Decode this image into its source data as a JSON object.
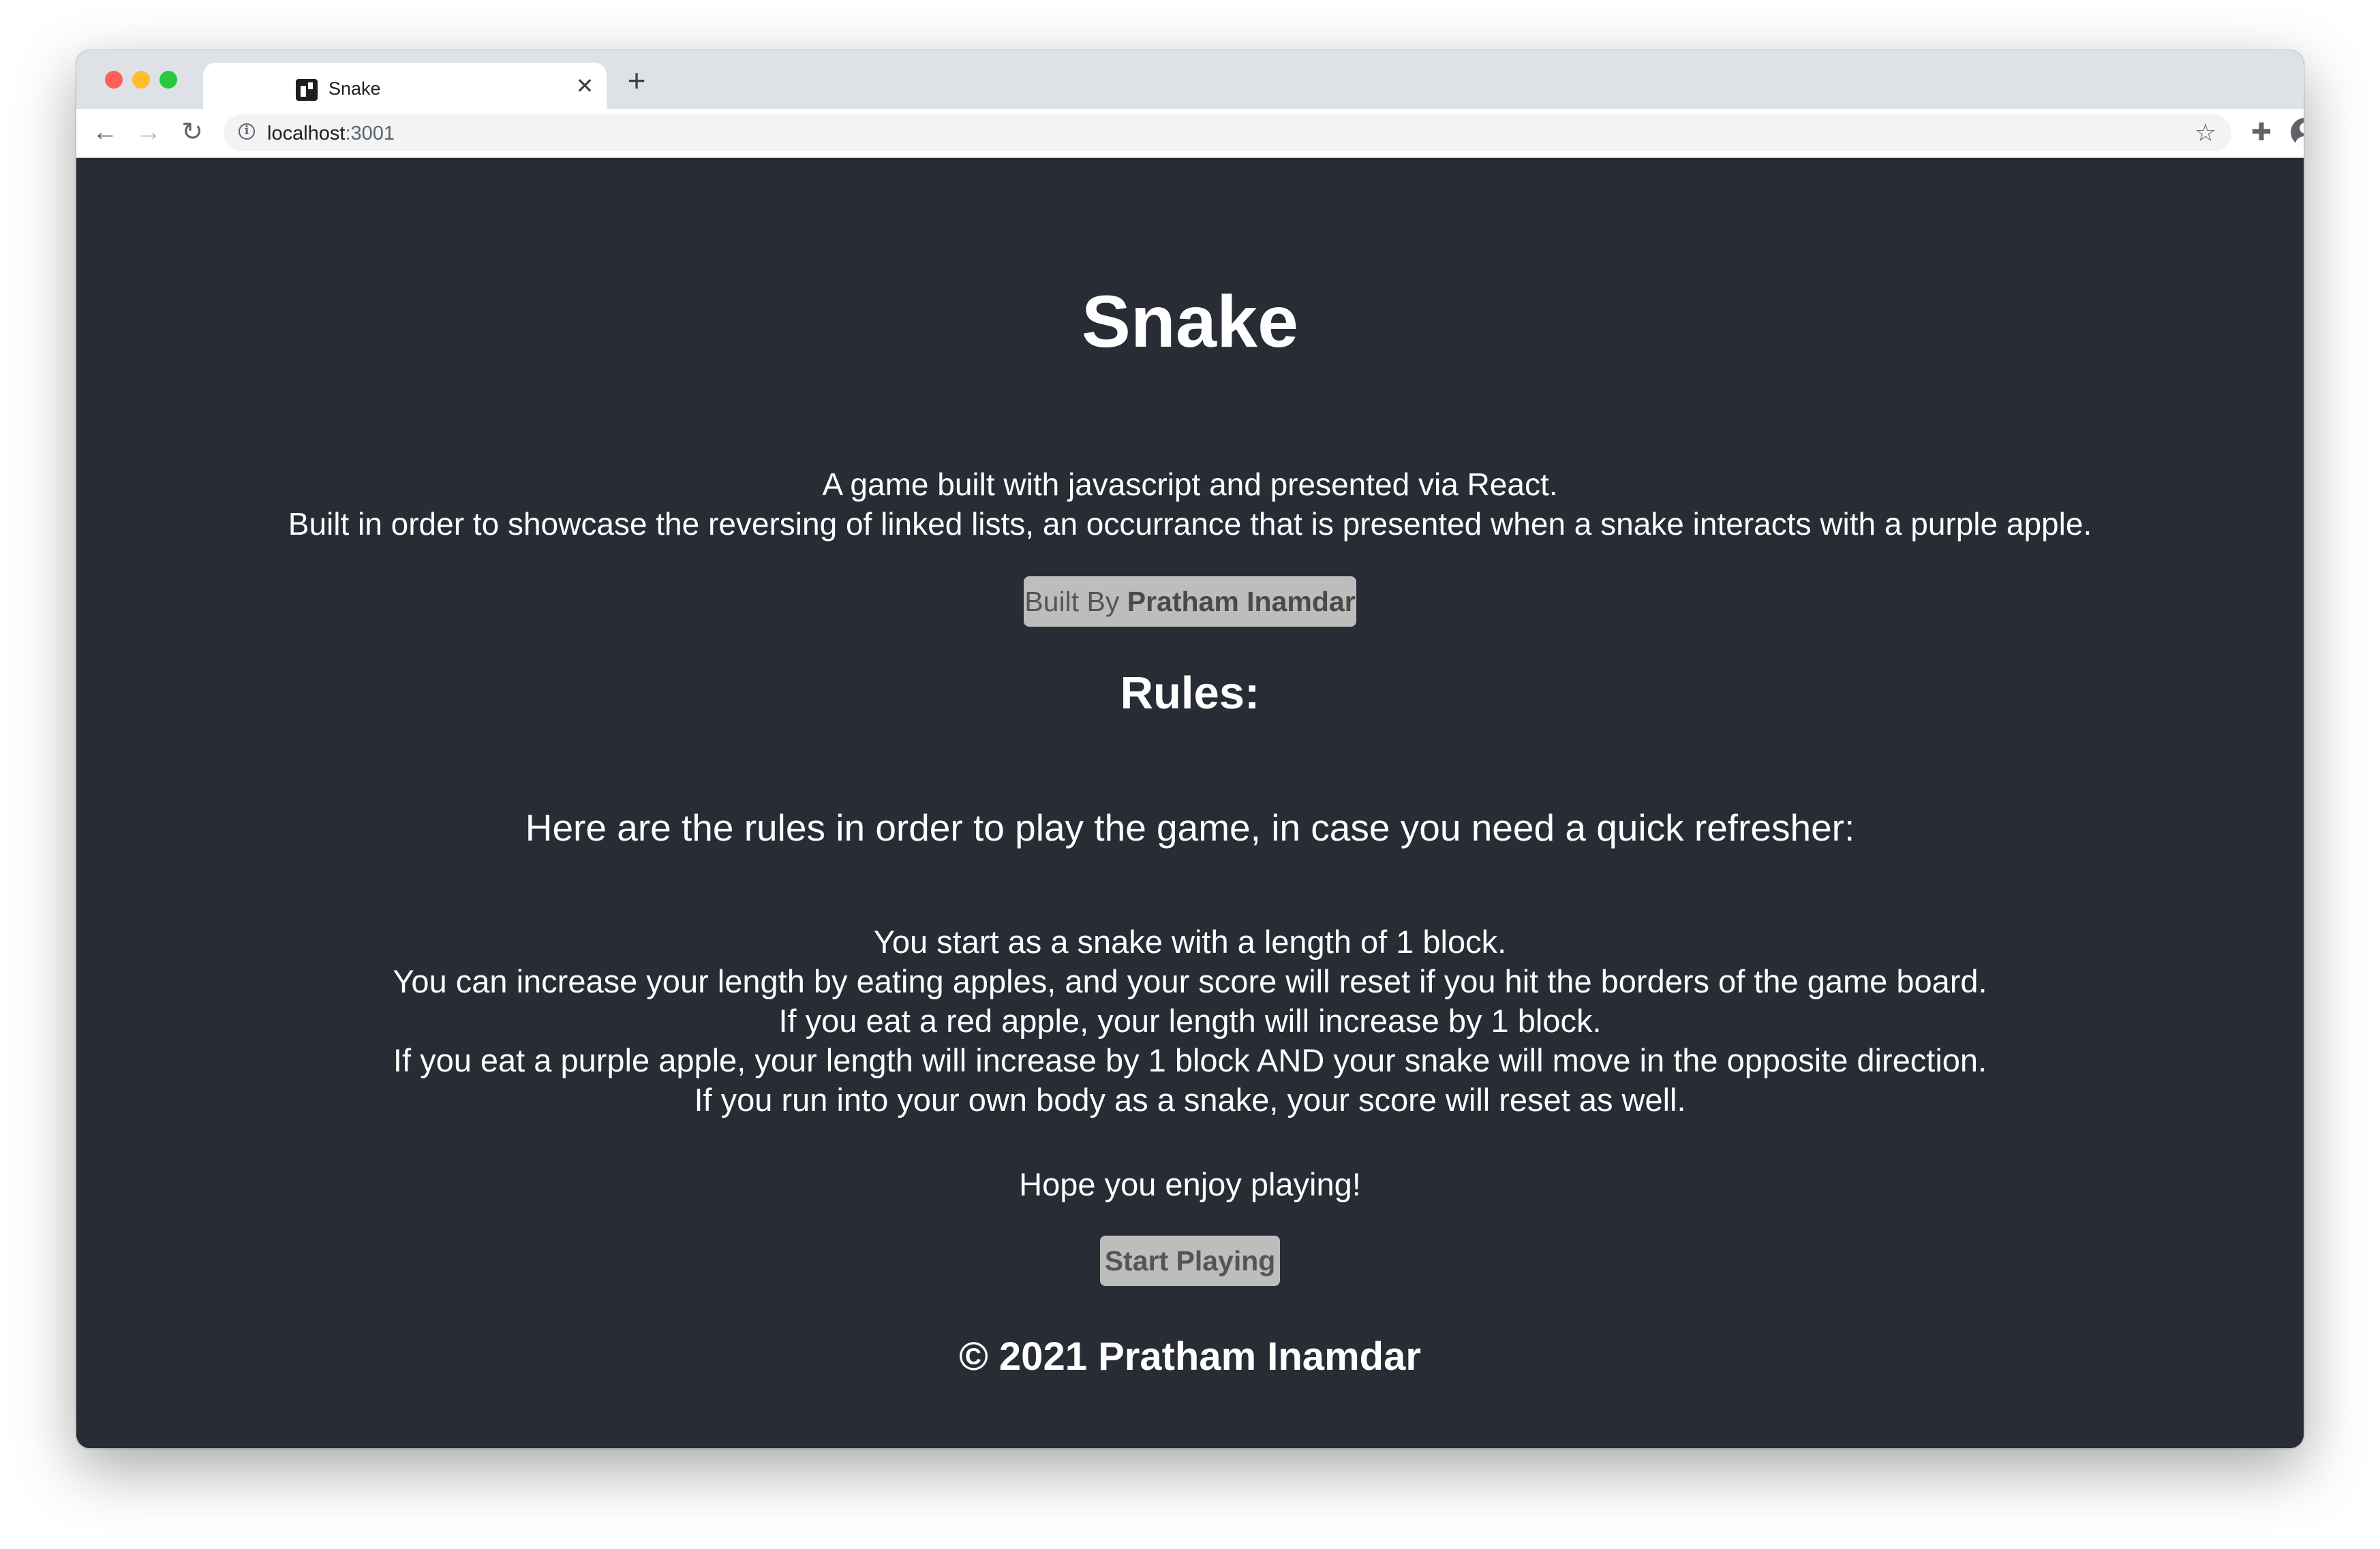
{
  "browser": {
    "tab": {
      "title": "Snake",
      "favicon": "react-app-icon",
      "close_glyph": "✕"
    },
    "new_tab_glyph": "+",
    "toolbar": {
      "back_glyph": "←",
      "forward_glyph": "→",
      "reload_glyph": "↻",
      "url_host": "localhost",
      "url_port": ":3001",
      "bookmark_glyph": "☆",
      "extensions_glyph": "✚",
      "menu_glyph": "⋮"
    },
    "traffic_lights": {
      "close": "#ff5f57",
      "minimize": "#febc2e",
      "maximize": "#28c840"
    }
  },
  "page": {
    "background": "#282c34",
    "title": "Snake",
    "intro_line1": "A game built with javascript and presented via React.",
    "intro_line2": "Built in order to showcase the reversing of linked lists, an occurrance that is presented when a snake interacts with a purple apple.",
    "built_by_prefix": "Built By ",
    "built_by_name": "Pratham Inamdar",
    "rules_heading": "Rules:",
    "rules_intro": "Here are the rules in order to play the game, in case you need a quick refresher:",
    "rules": [
      "You start as a snake with a length of 1 block.",
      "You can increase your length by eating apples, and your score will reset if you hit the borders of the game board.",
      "If you eat a red apple, your length will increase by 1 block.",
      "If you eat a purple apple, your length will increase by 1 block AND your snake will move in the opposite direction.",
      "If you run into your own body as a snake, your score will reset as well."
    ],
    "closing": "Hope you enjoy playing!",
    "start_button": "Start Playing",
    "footer": "© 2021 Pratham Inamdar"
  }
}
